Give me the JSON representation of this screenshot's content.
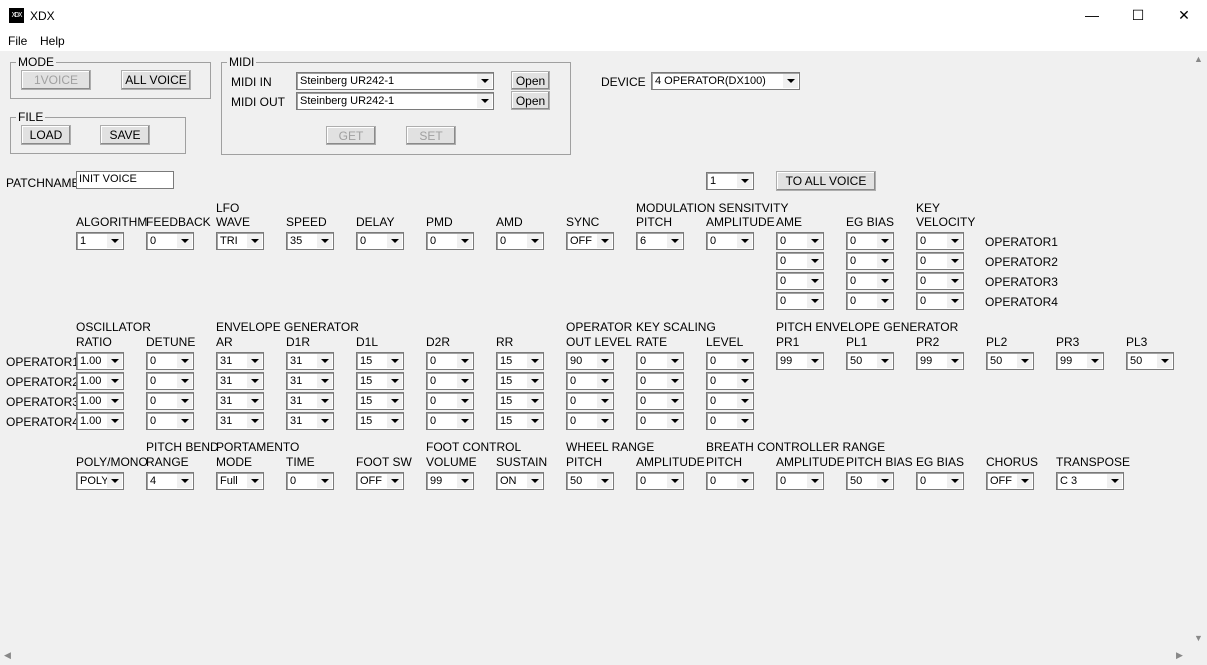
{
  "window": {
    "title": "XDX",
    "icon_text": "XDX",
    "minimize": "—",
    "maximize": "☐",
    "close": "✕"
  },
  "menu": {
    "file": "File",
    "help": "Help"
  },
  "mode": {
    "legend": "MODE",
    "one_voice": "1VOICE",
    "all_voice": "ALL VOICE"
  },
  "file_group": {
    "legend": "FILE",
    "load": "LOAD",
    "save": "SAVE"
  },
  "midi": {
    "legend": "MIDI",
    "in_label": "MIDI IN",
    "out_label": "MIDI OUT",
    "in_value": "Steinberg UR242-1",
    "out_value": "Steinberg UR242-1",
    "open": "Open",
    "get": "GET",
    "set": "SET"
  },
  "device": {
    "label": "DEVICE",
    "value": "4 OPERATOR(DX100)"
  },
  "patch": {
    "label": "PATCHNAME",
    "value": "INIT VOICE",
    "voice_no": "1",
    "to_all": "TO ALL VOICE"
  },
  "row1": {
    "labels": [
      "ALGORITHM",
      "FEEDBACK",
      "LFO",
      "WAVE",
      "SPEED",
      "DELAY",
      "PMD",
      "AMD",
      "SYNC",
      "MODULATION SENSITVITY",
      "PITCH",
      "AMPLITUDE",
      "AME",
      "EG BIAS",
      "KEY",
      "VELOCITY"
    ],
    "values": [
      "1",
      "0",
      "TRI",
      "35",
      "0",
      "0",
      "0",
      "OFF",
      "6",
      "0"
    ]
  },
  "op_sens": {
    "ame": [
      "0",
      "0",
      "0",
      "0"
    ],
    "eg_bias": [
      "0",
      "0",
      "0",
      "0"
    ],
    "velocity": [
      "0",
      "0",
      "0",
      "0"
    ],
    "ops": [
      "OPERATOR1",
      "OPERATOR2",
      "OPERATOR3",
      "OPERATOR4"
    ]
  },
  "row2": {
    "labels": [
      "OSCILLATOR",
      "RATIO",
      "DETUNE",
      "ENVELOPE GENERATOR",
      "AR",
      "D1R",
      "D1L",
      "D2R",
      "RR",
      "OPERATOR",
      "OUT LEVEL",
      "KEY SCALING",
      "RATE",
      "LEVEL",
      "PITCH ENVELOPE GENERATOR",
      "PR1",
      "PL1",
      "PR2",
      "PL2",
      "PR3",
      "PL3"
    ],
    "ops": [
      "OPERATOR1",
      "OPERATOR2",
      "OPERATOR3",
      "OPERATOR4"
    ],
    "ratio": [
      "1.00",
      "1.00",
      "1.00",
      "1.00"
    ],
    "detune": [
      "0",
      "0",
      "0",
      "0"
    ],
    "ar": [
      "31",
      "31",
      "31",
      "31"
    ],
    "d1r": [
      "31",
      "31",
      "31",
      "31"
    ],
    "d1l": [
      "15",
      "15",
      "15",
      "15"
    ],
    "d2r": [
      "0",
      "0",
      "0",
      "0"
    ],
    "rr": [
      "15",
      "15",
      "15",
      "15"
    ],
    "out_level": [
      "90",
      "0",
      "0",
      "0"
    ],
    "rate": [
      "0",
      "0",
      "0",
      "0"
    ],
    "level": [
      "0",
      "0",
      "0",
      "0"
    ],
    "peg": [
      "99",
      "50",
      "99",
      "50",
      "99",
      "50"
    ]
  },
  "row3": {
    "labels": [
      "POLY/MONO",
      "PITCH BEND",
      "RANGE",
      "PORTAMENTO",
      "MODE",
      "TIME",
      "FOOT SW",
      "FOOT CONTROL",
      "VOLUME",
      "SUSTAIN",
      "WHEEL RANGE",
      "PITCH",
      "AMPLITUDE",
      "BREATH CONTROLLER RANGE",
      "PITCH",
      "AMPLITUDE",
      "PITCH BIAS",
      "EG BIAS",
      "CHORUS",
      "TRANSPOSE"
    ],
    "values": [
      "POLY",
      "4",
      "Full",
      "0",
      "OFF",
      "99",
      "ON",
      "50",
      "0",
      "0",
      "0",
      "50",
      "0",
      "OFF",
      "C 3"
    ]
  }
}
